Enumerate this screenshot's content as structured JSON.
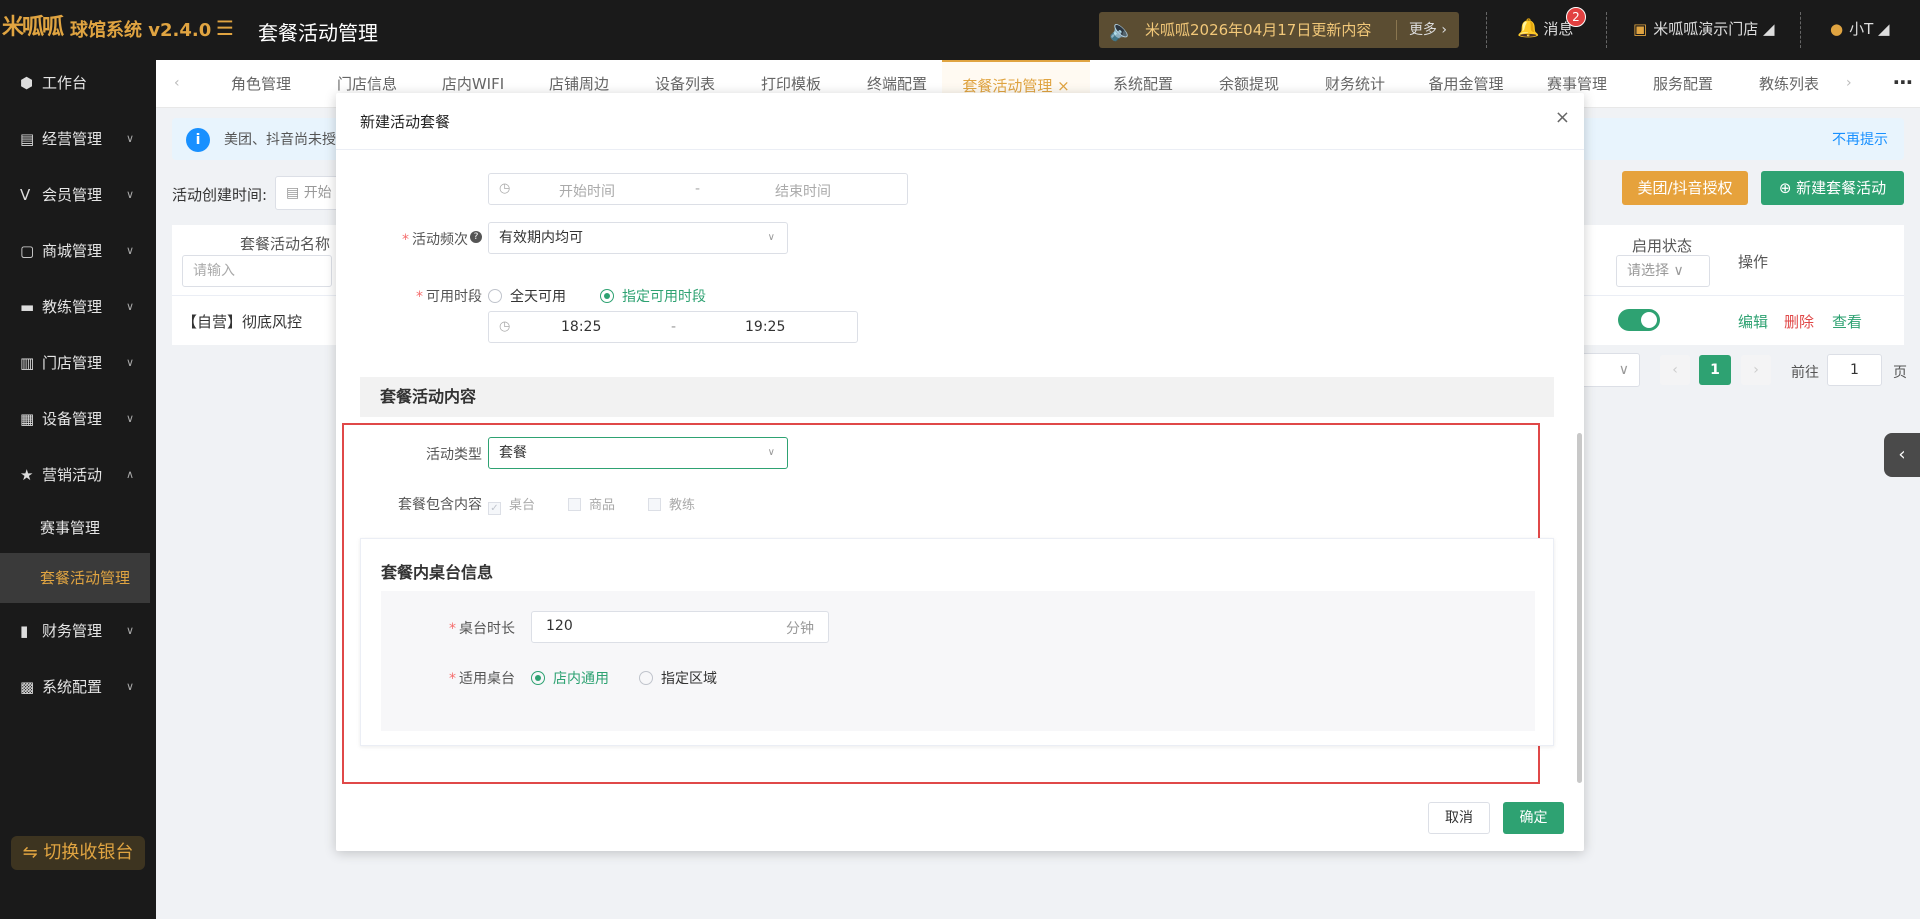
{
  "header": {
    "logo_text": "米呱呱",
    "brand": "球馆系统 v2.4.0",
    "page_title": "套餐活动管理",
    "notice": "米呱呱2026年04月17日更新内容",
    "notice_more": "更多",
    "messages_label": "消息",
    "messages_badge": "2",
    "store_name": "米呱呱演示门店",
    "user_name": "小T",
    "colors": {
      "accent": "#e0a441",
      "primary_green": "#2ea272",
      "danger": "#e04848"
    }
  },
  "sidebar": {
    "items": [
      {
        "label": "工作台",
        "icon": "cube-icon"
      },
      {
        "label": "经营管理",
        "icon": "chart-icon"
      },
      {
        "label": "会员管理",
        "icon": "member-icon"
      },
      {
        "label": "商城管理",
        "icon": "shop-icon"
      },
      {
        "label": "教练管理",
        "icon": "coach-icon"
      },
      {
        "label": "门店管理",
        "icon": "store-icon"
      },
      {
        "label": "设备管理",
        "icon": "device-icon"
      },
      {
        "label": "营销活动",
        "icon": "star-icon"
      }
    ],
    "sub_items": [
      "赛事管理",
      "套餐活动管理"
    ],
    "items_after": [
      {
        "label": "财务管理",
        "icon": "finance-icon"
      },
      {
        "label": "系统配置",
        "icon": "grid-icon"
      }
    ],
    "cashier_button": "切换收银台"
  },
  "tabs": [
    "角色管理",
    "门店信息",
    "店内WIFI",
    "店铺周边",
    "设备列表",
    "打印模板",
    "终端配置",
    "套餐活动管理",
    "系统配置",
    "余额提现",
    "财务统计",
    "备用金管理",
    "赛事管理",
    "服务配置",
    "教练列表"
  ],
  "info_bar": {
    "text": "美团、抖音尚未授",
    "dismiss": "不再提示"
  },
  "filter": {
    "label": "活动创建时间:",
    "date_placeholder": "开始"
  },
  "actions": {
    "meituan_button": "美团/抖音授权",
    "new_button": "新建套餐活动"
  },
  "table": {
    "col_name": "套餐活动名称",
    "name_placeholder": "请输入",
    "col_status": "启用状态",
    "status_placeholder": "请选择",
    "col_ops": "操作",
    "rows": [
      {
        "name": "【自营】彻底风控",
        "enabled": true
      }
    ],
    "ops": [
      "编辑",
      "删除",
      "查看"
    ]
  },
  "pagination": {
    "current": "1",
    "goto_label": "前往",
    "goto_value": "1",
    "page_label": "页"
  },
  "modal": {
    "title": "新建活动套餐",
    "date_range": {
      "start_placeholder": "开始时间",
      "sep": "-",
      "end_placeholder": "结束时间"
    },
    "frequency": {
      "label": "活动频次",
      "value": "有效期内均可"
    },
    "available_time": {
      "label": "可用时段",
      "option_all": "全天可用",
      "option_specific": "指定可用时段",
      "start": "18:25",
      "sep": "-",
      "end": "19:25"
    },
    "section_title": "套餐活动内容",
    "activity_type": {
      "label": "活动类型",
      "value": "套餐"
    },
    "includes": {
      "label": "套餐包含内容",
      "options": [
        "桌台",
        "商品",
        "教练"
      ]
    },
    "table_info": {
      "title": "套餐内桌台信息",
      "duration_label": "桌台时长",
      "duration_value": "120",
      "duration_unit": "分钟",
      "applies_label": "适用桌台",
      "option_store": "店内通用",
      "option_area": "指定区域"
    },
    "cancel": "取消",
    "confirm": "确定"
  }
}
